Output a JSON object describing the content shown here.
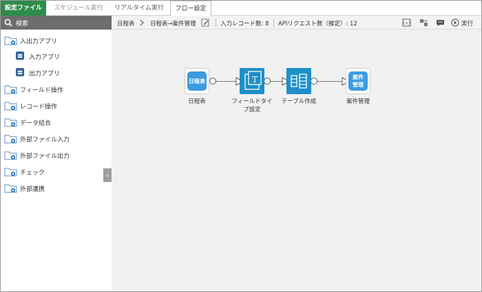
{
  "tabs": [
    {
      "label": "設定ファイル",
      "state": "active"
    },
    {
      "label": "スケジュール実行",
      "state": "disabled"
    },
    {
      "label": "リアルタイム実行",
      "state": "normal"
    },
    {
      "label": "フロー設定",
      "state": "selected"
    }
  ],
  "sidebar": {
    "search_label": "検索",
    "categories": [
      {
        "label": "入出力アプリ",
        "icon": "folder-gear-icon",
        "children": [
          {
            "label": "入力アプリ",
            "icon": "app-icon"
          },
          {
            "label": "出力アプリ",
            "icon": "app-icon"
          }
        ]
      },
      {
        "label": "フィールド操作",
        "icon": "folder-gear-icon"
      },
      {
        "label": "レコード操作",
        "icon": "folder-gear-icon"
      },
      {
        "label": "データ結合",
        "icon": "folder-gear-icon"
      },
      {
        "label": "外部ファイル入力",
        "icon": "folder-gear-icon"
      },
      {
        "label": "外部ファイル出力",
        "icon": "folder-gear-icon"
      },
      {
        "label": "チェック",
        "icon": "folder-gear-icon"
      },
      {
        "label": "外部連携",
        "icon": "folder-gear-icon"
      }
    ],
    "collapse_glyph": "‹"
  },
  "toolbar": {
    "breadcrumb_root": "日程表",
    "breadcrumb_flow": "日程表→案件管理",
    "input_records": "入力レコード数: 8",
    "api_requests": "APIリクエスト数（推定）: 12",
    "run_label": "実行"
  },
  "flow": {
    "nodes": [
      {
        "label": "日程表",
        "icon_text": "日程表",
        "color": "#3d9be0"
      },
      {
        "label": "フィールドタイプ設定",
        "label_line1": "フィールドタイ",
        "label_line2": "プ設定",
        "icon_text": "T",
        "color": "#1e8fc7"
      },
      {
        "label": "テーブル作成",
        "color": "#1e8fc7"
      },
      {
        "label": "案件管理",
        "icon_text_line1": "案件",
        "icon_text_line2": "管理",
        "color": "#3d9be0"
      }
    ]
  },
  "colors": {
    "active_tab": "#2f8c4a",
    "search_bar": "#6d6d6d",
    "canvas": "#f1f1f1"
  }
}
